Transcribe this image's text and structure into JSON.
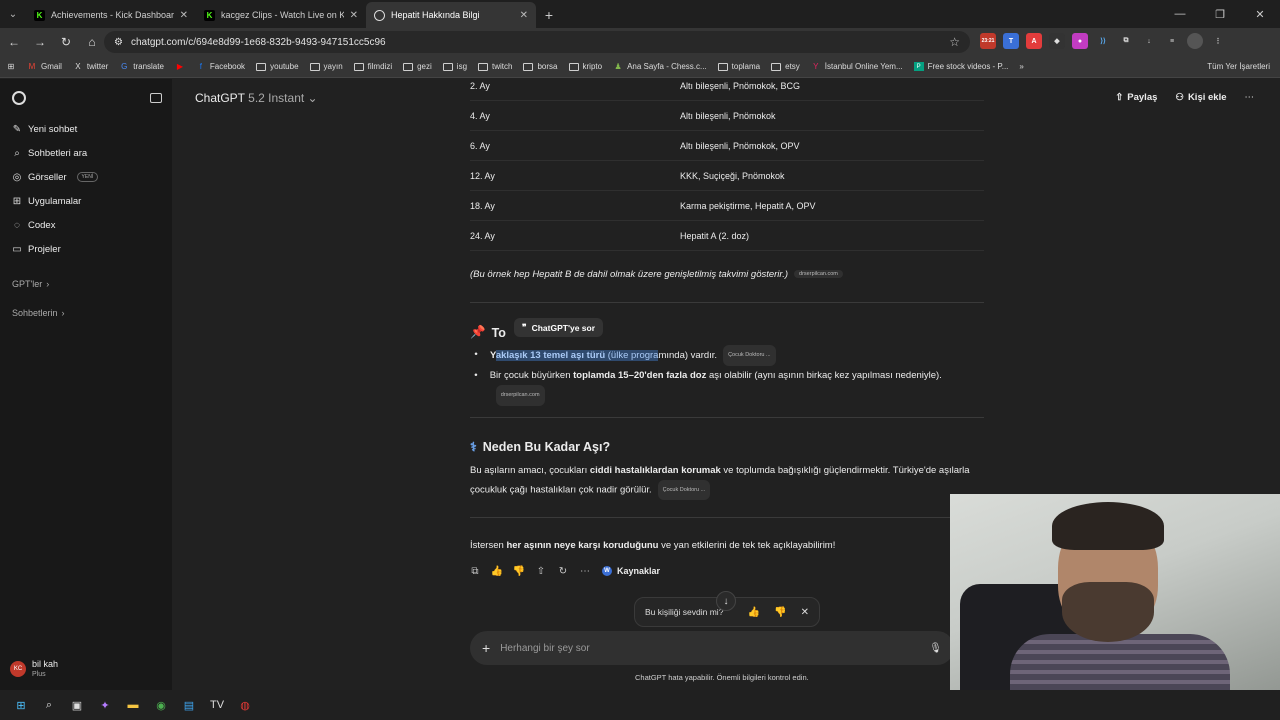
{
  "browser": {
    "tabs": [
      {
        "title": "Achievements - Kick Dashboard",
        "active": false
      },
      {
        "title": "kacgez Clips - Watch Live on Ki",
        "active": false
      },
      {
        "title": "Hepatit Hakkında Bilgi",
        "active": true
      }
    ],
    "url": "chatgpt.com/c/694e8d99-1e68-832b-9493-947151cc5c96",
    "ext_badge": "23:21",
    "bookmarks": [
      "Gmail",
      "twitter",
      "translate",
      "Facebook",
      "youtube",
      "yayın",
      "filmdizi",
      "gezi",
      "isg",
      "twitch",
      "borsa",
      "kripto",
      "Ana Sayfa - Chess.c...",
      "toplama",
      "etsy",
      "İstanbul Online Yem...",
      "Free stock videos - P..."
    ],
    "bookmarks_right": "Tüm Yer İşaretleri"
  },
  "sidebar": {
    "items": [
      {
        "label": "Yeni sohbet",
        "icon": "edit-icon"
      },
      {
        "label": "Sohbetleri ara",
        "icon": "search-icon"
      },
      {
        "label": "Görseller",
        "icon": "image-icon",
        "badge": "YENİ"
      },
      {
        "label": "Uygulamalar",
        "icon": "apps-icon"
      },
      {
        "label": "Codex",
        "icon": "codex-icon"
      },
      {
        "label": "Projeler",
        "icon": "folder-icon"
      }
    ],
    "sections": [
      "GPT'ler",
      "Sohbetlerin"
    ],
    "user": {
      "initials": "KC",
      "name": "bil kah",
      "plan": "Plus"
    }
  },
  "header": {
    "model": "ChatGPT",
    "version": "5.2 Instant",
    "share": "Paylaş",
    "add_person": "Kişi ekle"
  },
  "table_rows": [
    {
      "age": "2. Ay",
      "vaccine": "Altı bileşenli, Pnömokok, BCG"
    },
    {
      "age": "4. Ay",
      "vaccine": "Altı bileşenli, Pnömokok"
    },
    {
      "age": "6. Ay",
      "vaccine": "Altı bileşenli, Pnömokok, OPV"
    },
    {
      "age": "12. Ay",
      "vaccine": "KKK, Suçiçeği, Pnömokok"
    },
    {
      "age": "18. Ay",
      "vaccine": "Karma pekiştirme, Hepatit A, OPV"
    },
    {
      "age": "24. Ay",
      "vaccine": "Hepatit A (2. doz)"
    }
  ],
  "note": "(Bu örnek hep Hepatit B de dahil olmak üzere genişletilmiş takvimi gösterir.)",
  "note_src": "drserpilcan.com",
  "section1": {
    "title_visible": "To",
    "tooltip": "ChatGPT'ye sor",
    "bullet1": {
      "before": "Y",
      "highlight_bold": "aklaşık 13 temel aşı türü",
      "highlight_rest": " (ülke progra",
      "after": "mında) vardır.",
      "src": "Çocuk Doktoru ..."
    },
    "bullet2": {
      "before": "Bir çocuk büyürken ",
      "bold": "toplamda 15–20'den fazla doz",
      "after": " aşı olabilir (aynı aşının birkaç kez yapılması nedeniyle).",
      "src": "drserpilcan.com"
    }
  },
  "section2": {
    "title": "Neden Bu Kadar Aşı?",
    "p_before": "Bu aşıların amacı, çocukları ",
    "p_bold": "ciddi hastalıklardan korumak",
    "p_after": " ve toplumda bağışıklığı güçlendirmektir. Türkiye'de aşılarla çocukluk çağı hastalıkları çok nadir görülür.",
    "src": "Çocuk Doktoru ..."
  },
  "closing": {
    "before": "İstersen ",
    "bold": "her aşının neye karşı koruduğunu",
    "after": " ve yan etkilerini de tek tek açıklayabilirim!"
  },
  "actions": {
    "sources": "Kaynaklar"
  },
  "feedback": {
    "text": "Bu kişiliği sevdin mi?"
  },
  "composer": {
    "placeholder": "Herhangi bir şey sor",
    "disclaimer": "ChatGPT hata yapabilir. Önemli bilgileri kontrol edin."
  }
}
